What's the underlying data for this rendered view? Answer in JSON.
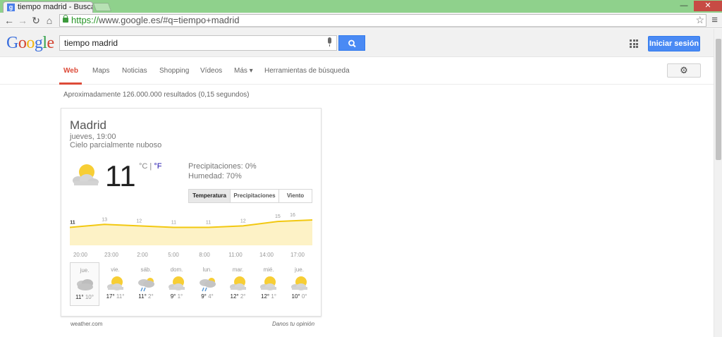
{
  "browser": {
    "tab_title": "tiempo madrid - Buscar c",
    "url_https": "https://",
    "url_rest": "www.google.es/#q=tiempo+madrid"
  },
  "google": {
    "logo_letters": [
      "G",
      "o",
      "o",
      "g",
      "l",
      "e"
    ],
    "logo_colors": [
      "#3b6fdd",
      "#d3432f",
      "#f2b40d",
      "#3b6fdd",
      "#35a14c",
      "#d3432f"
    ],
    "query": "tiempo madrid",
    "signin_label": "Iniciar sesión"
  },
  "tabs": [
    {
      "label": "Web",
      "active": true
    },
    {
      "label": "Maps"
    },
    {
      "label": "Noticias"
    },
    {
      "label": "Shopping"
    },
    {
      "label": "Vídeos"
    },
    {
      "label": "Más ▾"
    },
    {
      "label": "Herramientas de búsqueda"
    }
  ],
  "result_stats": "Aproximadamente 126.000.000 resultados (0,15 segundos)",
  "weather": {
    "city": "Madrid",
    "time": "jueves, 19:00",
    "condition": "Cielo parcialmente nuboso",
    "temp": "11",
    "unit_c": "°C",
    "unit_sep": " | ",
    "unit_f": "°F",
    "precip": "Precipitaciones: 0%",
    "humidity": "Humedad: 70%",
    "tabs": [
      "Temperatura",
      "Precipitaciones",
      "Viento"
    ],
    "source": "weather.com",
    "feedback": "Danos tu opinión",
    "days": [
      {
        "name": "jue.",
        "hi": "11°",
        "lo": "10°",
        "icon": "cloudy"
      },
      {
        "name": "vie.",
        "hi": "17°",
        "lo": "11°",
        "icon": "partly-cloudy"
      },
      {
        "name": "sáb.",
        "hi": "11°",
        "lo": "2°",
        "icon": "rain"
      },
      {
        "name": "dom.",
        "hi": "9°",
        "lo": "1°",
        "icon": "partly-cloudy"
      },
      {
        "name": "lun.",
        "hi": "9°",
        "lo": "4°",
        "icon": "rain"
      },
      {
        "name": "mar.",
        "hi": "12°",
        "lo": "2°",
        "icon": "partly-cloudy"
      },
      {
        "name": "mié.",
        "hi": "12°",
        "lo": "1°",
        "icon": "partly-cloudy"
      },
      {
        "name": "jue.",
        "hi": "10°",
        "lo": "0°",
        "icon": "partly-cloudy"
      }
    ]
  },
  "chart_data": {
    "type": "area",
    "x": [
      "20:00",
      "23:00",
      "2:00",
      "5:00",
      "8:00",
      "11:00",
      "14:00",
      "17:00"
    ],
    "values": [
      11,
      13,
      12,
      11,
      11,
      12,
      15,
      16
    ],
    "line_color": "#f2c811",
    "fill_color": "#fdf2c6"
  }
}
